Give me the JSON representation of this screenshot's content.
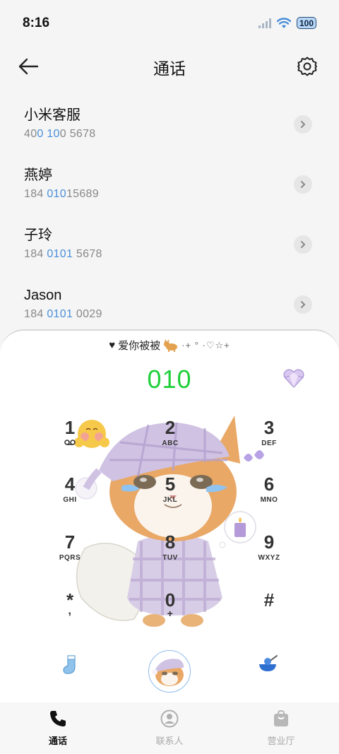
{
  "status": {
    "time": "8:16",
    "battery": "100"
  },
  "header": {
    "title": "通话"
  },
  "contacts": [
    {
      "name": "小米客服",
      "num_parts": [
        "40",
        "0 10",
        "0 5678"
      ]
    },
    {
      "name": "燕婷",
      "num_parts": [
        "184 ",
        "010",
        "15689"
      ]
    },
    {
      "name": "子玲",
      "num_parts": [
        "184 ",
        "0101",
        " 5678"
      ]
    },
    {
      "name": "Jason",
      "num_parts": [
        "184 ",
        "0101",
        " 0029"
      ]
    }
  ],
  "dialer": {
    "banner_text": "爱你被被",
    "banner_deco": "·+ ° ·♡☆+",
    "dialed_number": "010",
    "keys": [
      {
        "digit": "1",
        "letters": "oo"
      },
      {
        "digit": "2",
        "letters": "ABC"
      },
      {
        "digit": "3",
        "letters": "DEF"
      },
      {
        "digit": "4",
        "letters": "GHI"
      },
      {
        "digit": "5",
        "letters": "JKL"
      },
      {
        "digit": "6",
        "letters": "MNO"
      },
      {
        "digit": "7",
        "letters": "PQRS"
      },
      {
        "digit": "8",
        "letters": "TUV"
      },
      {
        "digit": "9",
        "letters": "WXYZ"
      },
      {
        "digit": "*",
        "letters": ","
      },
      {
        "digit": "0",
        "letters": "+"
      },
      {
        "digit": "#",
        "letters": ""
      }
    ]
  },
  "tabs": [
    {
      "label": "通话",
      "icon": "phone-icon",
      "active": true
    },
    {
      "label": "联系人",
      "icon": "contact-icon",
      "active": false
    },
    {
      "label": "营业厅",
      "icon": "store-bag-icon",
      "active": false
    }
  ],
  "colors": {
    "accent_green": "#1fcf3a",
    "highlight_blue": "#4a90d9"
  }
}
